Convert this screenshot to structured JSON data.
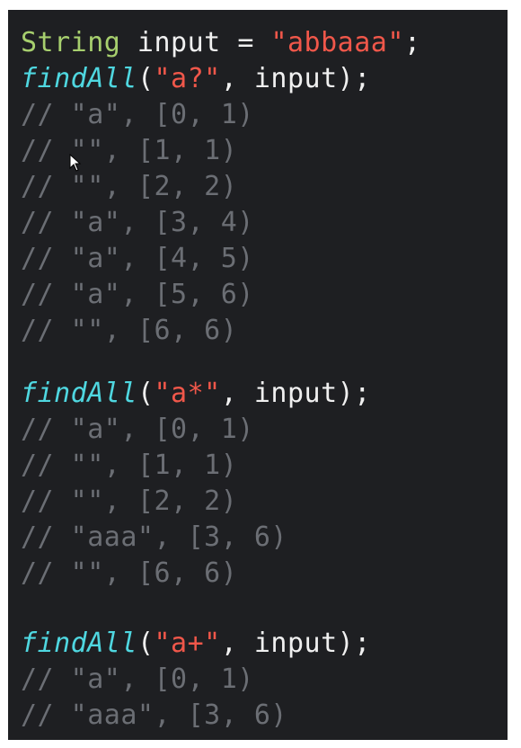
{
  "code": {
    "declaration": {
      "type": "String",
      "var": " input ",
      "eq": "= ",
      "value": "\"abbaaa\"",
      "end": ";"
    },
    "blocks": [
      {
        "fn": "findAll",
        "open": "(",
        "pattern": "\"a?\"",
        "args": ", input);",
        "results": [
          "// \"a\", [0, 1)",
          "// \"\", [1, 1)",
          "// \"\", [2, 2)",
          "// \"a\", [3, 4)",
          "// \"a\", [4, 5)",
          "// \"a\", [5, 6)",
          "// \"\", [6, 6)"
        ]
      },
      {
        "fn": "findAll",
        "open": "(",
        "pattern": "\"a*\"",
        "args": ", input);",
        "results": [
          "// \"a\", [0, 1)",
          "// \"\", [1, 1)",
          "// \"\", [2, 2)",
          "// \"aaa\", [3, 6)",
          "// \"\", [6, 6)"
        ]
      },
      {
        "fn": "findAll",
        "open": "(",
        "pattern": "\"a+\"",
        "args": ", input);",
        "results": [
          "// \"a\", [0, 1)",
          "// \"aaa\", [3, 6)"
        ]
      }
    ]
  },
  "colors": {
    "background": "#1e1f22",
    "keyword": "#a7cf6e",
    "string": "#f0574a",
    "function": "#4fd7e0",
    "comment": "#6b6e74",
    "text": "#f0f0f0"
  },
  "icons": {
    "cursor": "mouse-pointer-icon"
  }
}
